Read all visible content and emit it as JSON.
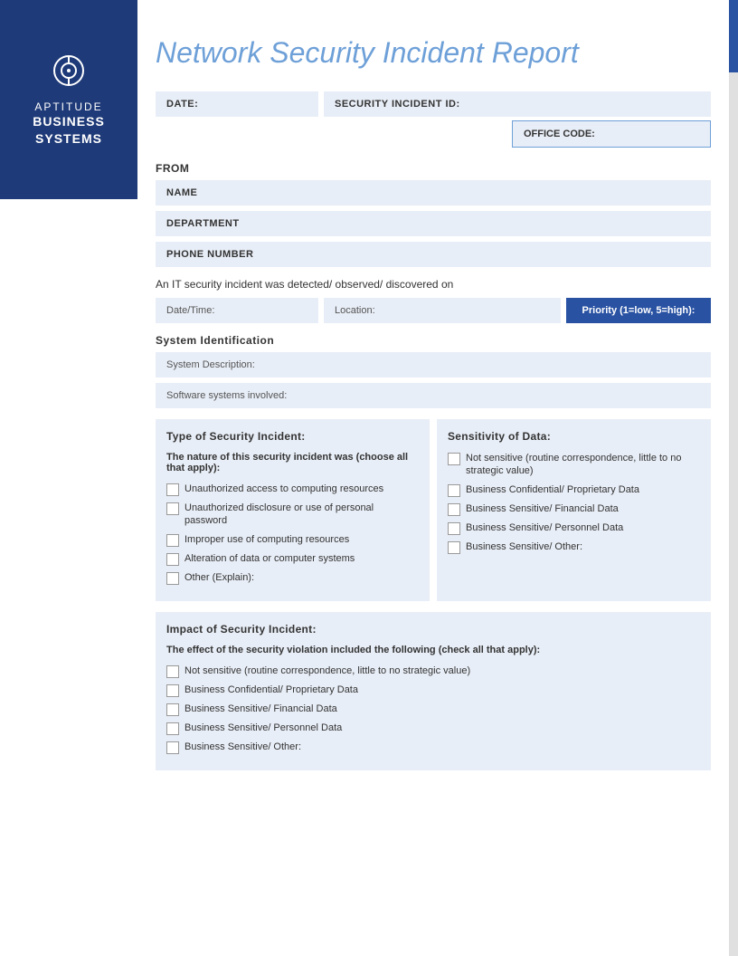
{
  "sidebar": {
    "icon_label": "target-icon",
    "aptitude_label": "APTITUDE",
    "business_label": "BUSINESS SYSTEMS"
  },
  "header": {
    "title": "Network Security Incident Report"
  },
  "form": {
    "date_label": "DATE:",
    "incident_id_label": "SECURITY INCIDENT ID:",
    "office_code_label": "OFFICE CODE:",
    "from_label": "FROM",
    "name_label": "NAME",
    "department_label": "DEPARTMENT",
    "phone_label": "PHONE NUMBER",
    "incident_detected_text": "An IT security incident was detected/ observed/ discovered on",
    "datetime_label": "Date/Time:",
    "location_label": "Location:",
    "priority_label": "Priority (1=low, 5=high):",
    "system_id_label": "System Identification",
    "system_desc_label": "System Description:",
    "software_label": "Software systems involved:",
    "type_header": "Type of Security Incident:",
    "nature_text": "The nature of this security incident was (choose all that apply):",
    "type_options": [
      "Unauthorized access to computing resources",
      "Unauthorized disclosure or use of personal password",
      "Improper use of computing resources",
      "Alteration of data or computer systems",
      "Other (Explain):"
    ],
    "sensitivity_header": "Sensitivity of Data:",
    "sensitivity_options": [
      "Not sensitive (routine correspondence, little to no strategic value)",
      "Business Confidential/ Proprietary Data",
      "Business Sensitive/ Financial Data",
      "Business Sensitive/ Personnel Data",
      "Business Sensitive/ Other:"
    ],
    "impact_header": "Impact of Security Incident:",
    "impact_text": "The effect of the security violation included the following (check all that apply):",
    "impact_options": [
      "Not sensitive (routine correspondence, little to no strategic value)",
      "Business Confidential/ Proprietary Data",
      "Business Sensitive/ Financial Data",
      "Business Sensitive/ Personnel Data",
      "Business Sensitive/ Other:"
    ]
  }
}
